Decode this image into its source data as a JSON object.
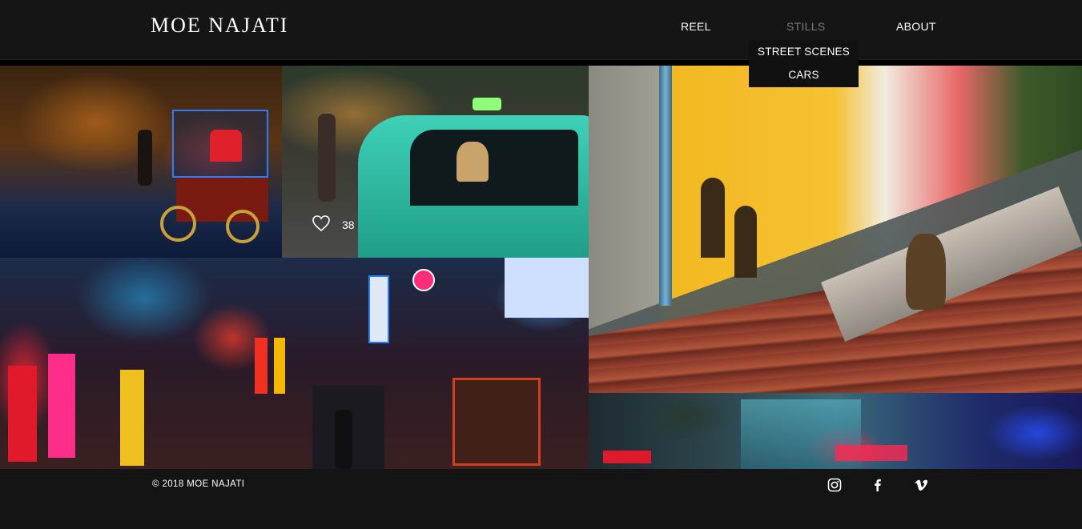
{
  "site": {
    "logo": "MOE NAJATI"
  },
  "nav": {
    "items": [
      {
        "label": "REEL"
      },
      {
        "label": "STILLS"
      },
      {
        "label": "ABOUT"
      }
    ],
    "stills_dropdown": [
      {
        "label": "STREET SCENES"
      },
      {
        "label": "CARS"
      }
    ]
  },
  "gallery": {
    "tiles": [
      {
        "name": "chestnut-cart"
      },
      {
        "name": "taxi",
        "likes": "38"
      },
      {
        "name": "cat-stairs"
      },
      {
        "name": "neon-street"
      },
      {
        "name": "tobacco-street"
      }
    ]
  },
  "footer": {
    "copyright": "© 2018 MOE NAJATI",
    "social": [
      {
        "icon": "instagram-icon"
      },
      {
        "icon": "facebook-icon"
      },
      {
        "icon": "vimeo-icon"
      }
    ]
  },
  "colors": {
    "background": "#141414",
    "text": "#ffffff",
    "nav_active": "#7a7a7a"
  }
}
